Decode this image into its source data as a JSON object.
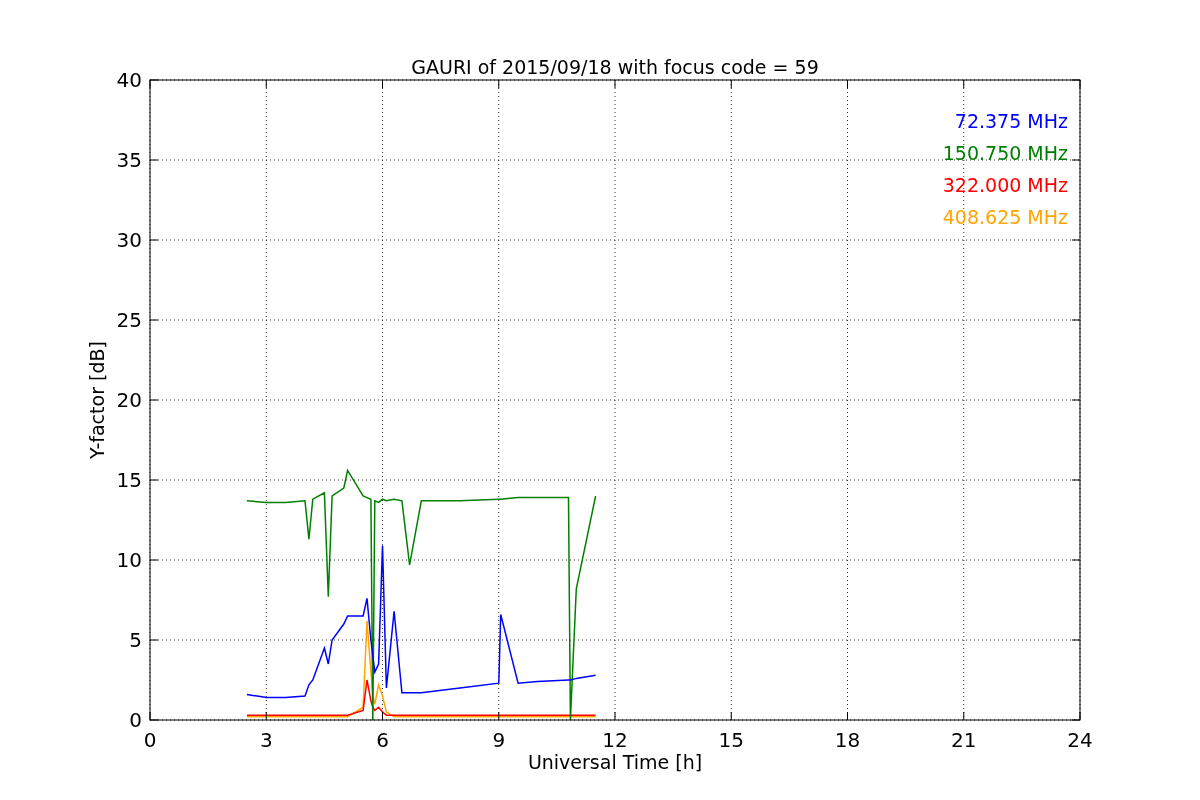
{
  "chart_data": {
    "type": "line",
    "title": "GAURI of 2015/09/18 with focus code = 59",
    "xlabel": "Universal Time [h]",
    "ylabel": "Y-factor [dB]",
    "x": [
      2.5,
      3.0,
      3.5,
      4.0,
      4.1,
      4.2,
      4.5,
      4.6,
      4.7,
      5.0,
      5.1,
      5.5,
      5.6,
      5.7,
      5.75,
      5.8,
      5.9,
      6.0,
      6.1,
      6.3,
      6.5,
      6.7,
      7.0,
      8.0,
      9.0,
      9.05,
      9.5,
      10.0,
      10.8,
      10.85,
      11.0,
      11.5
    ],
    "series": [
      {
        "name": "72.375 MHz",
        "color": "#0000ff",
        "values": [
          1.6,
          1.4,
          1.4,
          1.5,
          2.2,
          2.5,
          4.5,
          3.5,
          5.0,
          6.0,
          6.5,
          6.5,
          7.6,
          5.0,
          4.0,
          3.0,
          3.5,
          10.9,
          2.0,
          6.8,
          1.7,
          1.7,
          1.7,
          2.0,
          2.3,
          6.6,
          2.3,
          2.4,
          2.5,
          2.5,
          2.6,
          2.8
        ]
      },
      {
        "name": "150.750 MHz",
        "color": "#008000",
        "values": [
          13.7,
          13.6,
          13.6,
          13.7,
          11.3,
          13.8,
          14.2,
          7.7,
          14.0,
          14.5,
          15.6,
          14.0,
          13.9,
          13.8,
          0.0,
          13.7,
          13.6,
          13.8,
          13.7,
          13.8,
          13.7,
          9.7,
          13.7,
          13.7,
          13.8,
          13.8,
          13.9,
          13.9,
          13.9,
          0.0,
          8.2,
          14.0
        ]
      },
      {
        "name": "322.000 MHz",
        "color": "#ff0000",
        "values": [
          0.3,
          0.3,
          0.3,
          0.3,
          0.3,
          0.3,
          0.3,
          0.3,
          0.3,
          0.3,
          0.3,
          0.6,
          2.5,
          1.2,
          0.8,
          0.6,
          0.8,
          0.5,
          0.3,
          0.3,
          0.3,
          0.3,
          0.3,
          0.3,
          0.3,
          0.3,
          0.3,
          0.3,
          0.3,
          0.3,
          0.3,
          0.3
        ]
      },
      {
        "name": "408.625 MHz",
        "color": "#ffa500",
        "values": [
          0.2,
          0.2,
          0.2,
          0.2,
          0.2,
          0.2,
          0.2,
          0.2,
          0.2,
          0.2,
          0.2,
          0.8,
          6.2,
          3.0,
          1.5,
          1.0,
          2.2,
          1.5,
          0.5,
          0.2,
          0.2,
          0.2,
          0.2,
          0.2,
          0.2,
          0.2,
          0.2,
          0.2,
          0.2,
          0.2,
          0.2,
          0.2
        ]
      }
    ],
    "grid": true,
    "xlim": [
      0,
      24
    ],
    "ylim": [
      0,
      40
    ],
    "xticks": [
      0,
      3,
      6,
      9,
      12,
      15,
      18,
      21,
      24
    ],
    "yticks": [
      0,
      5,
      10,
      15,
      20,
      25,
      30,
      35,
      40
    ]
  }
}
